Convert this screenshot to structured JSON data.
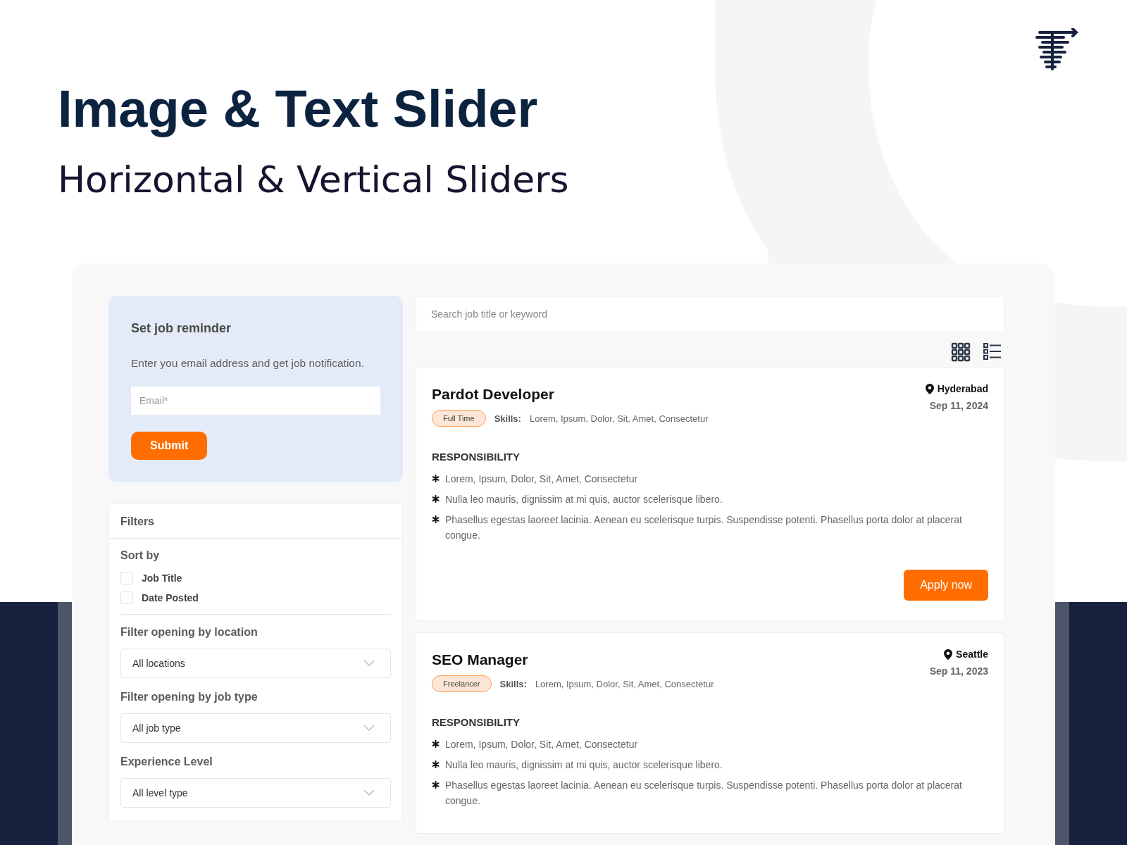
{
  "hero": {
    "title": "Image & Text Slider",
    "subtitle": "Horizontal & Vertical Sliders"
  },
  "reminder": {
    "title": "Set job reminder",
    "text": "Enter you email address and get job notification.",
    "email": {
      "placeholder": "Email*"
    },
    "button": "Submit"
  },
  "filters": {
    "title": "Filters",
    "sort": {
      "label": "Sort by",
      "options": [
        {
          "label": "Job Title",
          "checked": false
        },
        {
          "label": "Date Posted",
          "checked": false
        }
      ]
    },
    "dropdowns": [
      {
        "label": "Filter opening by location",
        "value": "All locations"
      },
      {
        "label": "Filter opening by job type",
        "value": "All job type"
      },
      {
        "label": "Experience Level",
        "value": "All level type"
      }
    ]
  },
  "search": {
    "placeholder": "Search job title or keyword"
  },
  "jobs": [
    {
      "title": "Pardot Developer",
      "type": "Full Time",
      "skills_label": "Skills:",
      "skills": "Lorem, Ipsum, Dolor, Sit, Amet, Consectetur",
      "location": "Hyderabad",
      "date": "Sep 11, 2024",
      "section": "RESPONSIBILITY",
      "bullets": [
        "Lorem, Ipsum, Dolor, Sit, Amet, Consectetur",
        "Nulla leo mauris, dignissim at mi quis, auctor scelerisque libero.",
        "Phasellus egestas laoreet lacinia. Aenean eu scelerisque turpis. Suspendisse potenti. Phasellus porta dolor at placerat congue."
      ],
      "button": "Apply now"
    },
    {
      "title": "SEO Manager",
      "type": "Freelancer",
      "skills_label": "Skills:",
      "skills": "Lorem, Ipsum, Dolor, Sit, Amet, Consectetur",
      "location": "Seattle",
      "date": "Sep 11, 2023",
      "section": "RESPONSIBILITY",
      "bullets": [
        "Lorem, Ipsum, Dolor, Sit, Amet, Consectetur",
        "Nulla leo mauris, dignissim at mi quis, auctor scelerisque libero.",
        "Phasellus egestas laoreet lacinia. Aenean eu scelerisque turpis. Suspendisse potenti. Phasellus porta dolor at placerat congue."
      ]
    }
  ]
}
